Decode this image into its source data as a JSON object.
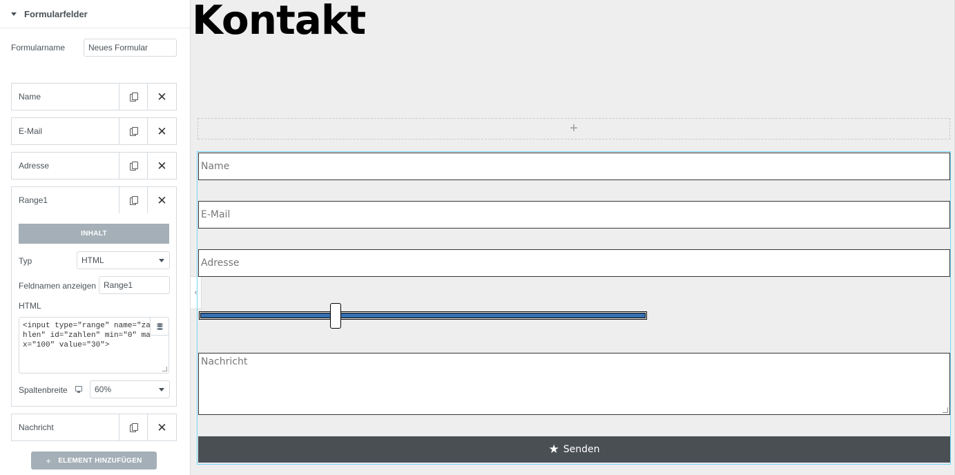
{
  "sidebar": {
    "section_title": "Formularfelder",
    "form_name_label": "Formularname",
    "form_name_value": "Neues Formular",
    "fields": [
      {
        "label": "Name"
      },
      {
        "label": "E-Mail"
      },
      {
        "label": "Adresse"
      },
      {
        "label": "Range1"
      },
      {
        "label": "Nachricht"
      }
    ],
    "panel": {
      "tab_label": "INHALT",
      "type_label": "Typ",
      "type_value": "HTML",
      "show_name_label": "Feldnamen anzeigen",
      "show_name_value": "Range1",
      "html_label": "HTML",
      "html_code": "<input type=\"range\" name=\"zahlen\" id=\"zahlen\" min=\"0\" max=\"100\" value=\"30\">",
      "column_width_label": "Spaltenbreite",
      "column_width_value": "60%"
    },
    "add_button_label": "ELEMENT HINZUFÜGEN"
  },
  "preview": {
    "title": "Kontakt",
    "add_section_symbol": "+",
    "inputs": [
      {
        "placeholder": "Name"
      },
      {
        "placeholder": "E-Mail"
      },
      {
        "placeholder": "Adresse"
      }
    ],
    "range": {
      "min": 0,
      "max": 100,
      "value": 30
    },
    "textarea_placeholder": "Nachricht",
    "submit_label": "Senden",
    "submit_icon": "star-icon"
  },
  "colors": {
    "accent_border": "#71d7f7",
    "button_dark": "#4a4f54",
    "tab_gray": "#a4afb7",
    "range_fill": "#3570b0"
  }
}
